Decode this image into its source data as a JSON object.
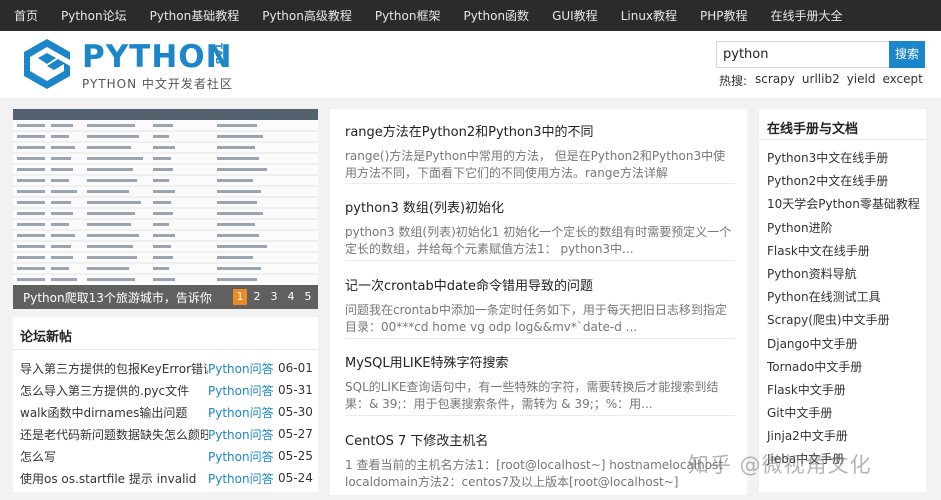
{
  "topnav": {
    "items": [
      "首页",
      "Python论坛",
      "Python基础教程",
      "Python高级教程",
      "Python框架",
      "Python函数",
      "GUI教程",
      "Linux教程",
      "PHP教程",
      "在线手册大全"
    ]
  },
  "header": {
    "logo_word": "PYTHON",
    "logo_tab": "TAB",
    "logo_sub": "PYTHON 中文开发者社区",
    "search_value": "python",
    "search_button": "搜索",
    "hot_label": "热搜:",
    "hot_words": [
      "scrapy",
      "urllib2",
      "yield",
      "except"
    ]
  },
  "slider": {
    "caption": "Python爬取13个旅游城市，告诉你...",
    "pages": [
      "1",
      "2",
      "3",
      "4",
      "5"
    ],
    "active_page": "1"
  },
  "forum": {
    "title": "论坛新帖",
    "rows": [
      {
        "title": "导入第三方提供的包报KeyError错误",
        "category": "Python问答",
        "date": "06-01"
      },
      {
        "title": "怎么导入第三方提供的.pyc文件",
        "category": "Python问答",
        "date": "05-31"
      },
      {
        "title": "walk函数中dirnames输出问题",
        "category": "Python问答",
        "date": "05-30"
      },
      {
        "title": "还是老代码新问题数据缺失怎么颜旺",
        "category": "Python问答",
        "date": "05-27"
      },
      {
        "title": "怎么写",
        "category": "Python问答",
        "date": "05-25"
      },
      {
        "title": "使用os os.startfile 提示 invalid",
        "category": "Python问答",
        "date": "05-24"
      }
    ]
  },
  "articles": [
    {
      "title": "range方法在Python2和Python3中的不同",
      "desc": "range()方法是Python中常用的方法， 但是在Python2和Python3中使用方法不同，下面看下它们的不同使用方法。range方法详解range(start, st"
    },
    {
      "title": "python3 数组(列表)初始化",
      "desc": "python3 数组(列表)初始化1 初始化一个定长的数组有时需要预定义一个定长的数组，并给每个元素赋值方法1： python3中..."
    },
    {
      "title": "记一次crontab中date命令错用导致的问题",
      "desc": "问题我在crontab中添加一条定时任务如下，用于每天把旧日志移到指定目录：00***cd home vg odp log&&mv*`date-d ..."
    },
    {
      "title": "MySQL用LIKE特殊字符搜索",
      "desc": "SQL的LIKE查询语句中，有一些特殊的字符，需要转换后才能搜索到结果：& 39;：用于包裹搜索条件，需转为 & 39;；%：用..."
    },
    {
      "title": "CentOS 7 下修改主机名",
      "desc": "1 查看当前的主机名方法1：[root@localhost~] hostnamelocalhost localdomain方法2：centos7及以上版本[root@localhost~] hostnamectlStati"
    }
  ],
  "manuals": {
    "title": "在线手册与文档",
    "items": [
      "Python3中文在线手册",
      "Python2中文在线手册",
      "10天学会Python零基础教程",
      "Python进阶",
      "Flask中文在线手册",
      "Python资料导航",
      "Python在线测试工具",
      "Scrapy(爬虫)中文手册",
      "Django中文手册",
      "Tornado中文手册",
      "Flask中文手册",
      "Git中文手册",
      "Jinja2中文手册",
      "Jieba中文手册"
    ]
  },
  "watermark": "知乎 @微视角文化",
  "colors": {
    "accent": "#1b86c9",
    "nav_bg": "#2b2b2b",
    "pager_active": "#f08a24"
  }
}
